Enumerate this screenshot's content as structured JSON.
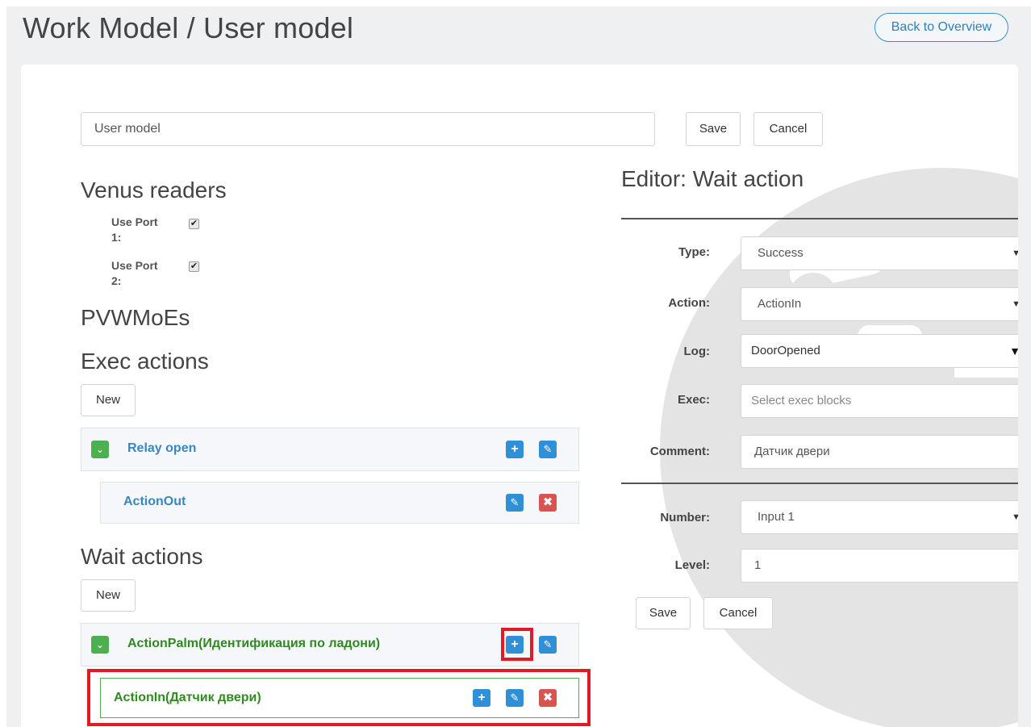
{
  "header": {
    "title": "Work Model / User model",
    "back_label": "Back to Overview"
  },
  "model": {
    "name_value": "User model",
    "save_label": "Save",
    "cancel_label": "Cancel"
  },
  "venus": {
    "heading": "Venus readers",
    "ports": [
      {
        "label": "Use Port 1:",
        "checked": true
      },
      {
        "label": "Use Port 2:",
        "checked": true
      }
    ]
  },
  "pvw": {
    "heading": "PVWMoEs"
  },
  "exec": {
    "heading": "Exec actions",
    "new_label": "New",
    "items": [
      {
        "label": "Relay open",
        "children": [
          {
            "label": "ActionOut"
          }
        ]
      }
    ]
  },
  "wait": {
    "heading": "Wait actions",
    "new_label": "New",
    "items": [
      {
        "label": "ActionPalm(Идентификация по ладони)",
        "children": [
          {
            "label": "ActionIn(Датчик двери)"
          }
        ]
      }
    ]
  },
  "editor": {
    "title": "Editor: Wait action",
    "fields": {
      "type": {
        "label": "Type:",
        "value": "Success"
      },
      "action": {
        "label": "Action:",
        "value": "ActionIn"
      },
      "log": {
        "label": "Log:",
        "value": "DoorOpened"
      },
      "exec": {
        "label": "Exec:",
        "placeholder": "Select exec blocks"
      },
      "comment": {
        "label": "Comment:",
        "value": "Датчик двери"
      },
      "number": {
        "label": "Number:",
        "value": "Input 1"
      },
      "level": {
        "label": "Level:",
        "value": "1"
      }
    },
    "save_label": "Save",
    "cancel_label": "Cancel"
  },
  "colors": {
    "accent_blue": "#2f8fd7",
    "link_blue": "#3a87c0",
    "green_text": "#2e8b1e",
    "toggle_green": "#4caf50",
    "delete_red": "#d9534f",
    "highlight_red": "#e01b24"
  },
  "icons": {
    "expand": "chevron-down-icon",
    "add": "plus-icon",
    "edit": "edit-icon",
    "delete": "close-icon"
  }
}
